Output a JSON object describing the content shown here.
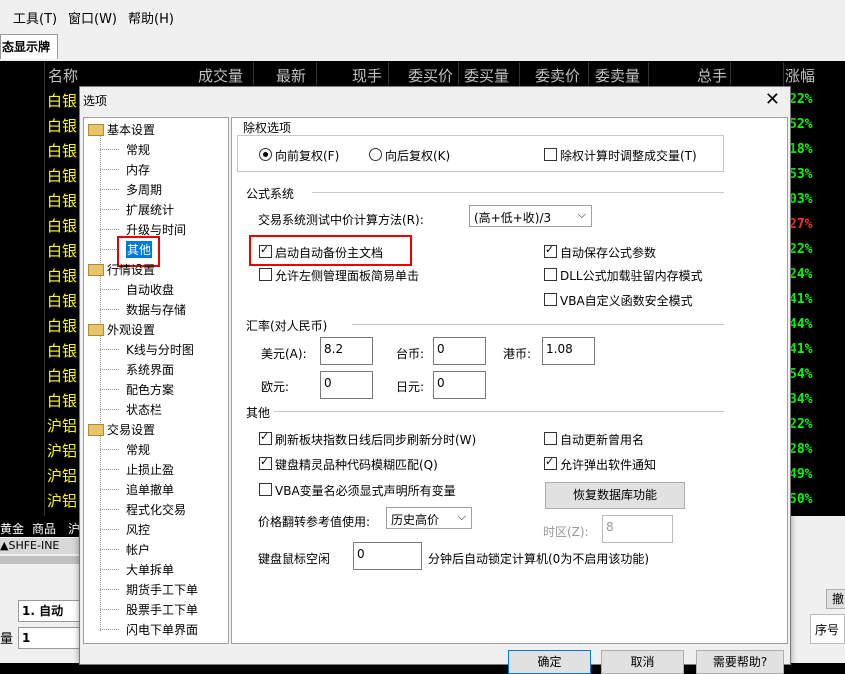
{
  "menubar": {
    "tools": "工具(T)",
    "window": "窗口(W)",
    "help": "帮助(H)"
  },
  "tab": {
    "label": "态显示牌"
  },
  "grid": {
    "headers": [
      "名称",
      "成交量",
      "最新",
      "现手",
      "委买价",
      "委买量",
      "委卖价",
      "委卖量",
      "总手",
      "涨幅"
    ],
    "rows": [
      {
        "name": "白银",
        "pct": "22%",
        "color": "#00ff00"
      },
      {
        "name": "白银",
        "pct": "52%",
        "color": "#00ff00"
      },
      {
        "name": "白银",
        "pct": "18%",
        "color": "#00ff00"
      },
      {
        "name": "白银",
        "pct": "53%",
        "color": "#00ff00"
      },
      {
        "name": "白银",
        "pct": "03%",
        "color": "#00ff00"
      },
      {
        "name": "白银",
        "pct": "27%",
        "color": "#ff3030"
      },
      {
        "name": "白银",
        "pct": "22%",
        "color": "#00ff00"
      },
      {
        "name": "白银",
        "pct": "24%",
        "color": "#00ff00"
      },
      {
        "name": "白银",
        "pct": "41%",
        "color": "#00ff00"
      },
      {
        "name": "白银",
        "pct": "44%",
        "color": "#00ff00"
      },
      {
        "name": "白银",
        "pct": "41%",
        "color": "#00ff00"
      },
      {
        "name": "白银",
        "pct": "54%",
        "color": "#00ff00"
      },
      {
        "name": "白银",
        "pct": "34%",
        "color": "#00ff00"
      },
      {
        "name": "沪铝",
        "pct": "22%",
        "color": "#00ff00"
      },
      {
        "name": "沪铝",
        "pct": "28%",
        "color": "#00ff00"
      },
      {
        "name": "沪铝",
        "pct": "49%",
        "color": "#00ff00"
      },
      {
        "name": "沪铝",
        "pct": "50%",
        "color": "#00ff00"
      }
    ]
  },
  "bottombar": {
    "tabs": [
      "黄金",
      "商品",
      "沪"
    ],
    "exchange": "▲SHFE-INE",
    "mode": "1. 自动",
    "qty_label": "量",
    "qty_value": "1",
    "btn_cancel_partial": "撤",
    "col_seq": "序号"
  },
  "dialog": {
    "title": "选项",
    "close": "✕",
    "tree": [
      {
        "label": "基本设置",
        "level": 0
      },
      {
        "label": "常规",
        "level": 1
      },
      {
        "label": "内存",
        "level": 1
      },
      {
        "label": "多周期",
        "level": 1
      },
      {
        "label": "扩展统计",
        "level": 1
      },
      {
        "label": "升级与时间",
        "level": 1
      },
      {
        "label": "其他",
        "level": 1,
        "selected": true
      },
      {
        "label": "行情设置",
        "level": 0
      },
      {
        "label": "自动收盘",
        "level": 1
      },
      {
        "label": "数据与存储",
        "level": 1
      },
      {
        "label": "外观设置",
        "level": 0
      },
      {
        "label": "K线与分时图",
        "level": 1
      },
      {
        "label": "系统界面",
        "level": 1
      },
      {
        "label": "配色方案",
        "level": 1
      },
      {
        "label": "状态栏",
        "level": 1
      },
      {
        "label": "交易设置",
        "level": 0
      },
      {
        "label": "常规",
        "level": 1
      },
      {
        "label": "止损止盈",
        "level": 1
      },
      {
        "label": "追单撤单",
        "level": 1
      },
      {
        "label": "程式化交易",
        "level": 1
      },
      {
        "label": "风控",
        "level": 1
      },
      {
        "label": "帐户",
        "level": 1
      },
      {
        "label": "大单拆单",
        "level": 1
      },
      {
        "label": "期货手工下单",
        "level": 1
      },
      {
        "label": "股票手工下单",
        "level": 1
      },
      {
        "label": "闪电下单界面",
        "level": 1
      }
    ],
    "exright": {
      "title": "除权选项",
      "forward": "向前复权(F)",
      "backward": "向后复权(K)",
      "adjust_volume": "除权计算时调整成交量(T)"
    },
    "formula": {
      "title": "公式系统",
      "test_label": "交易系统测试中价计算方法(R):",
      "test_value": "(高+低+收)/3",
      "auto_backup": "启动自动备份主文档",
      "auto_save": "自动保存公式参数",
      "left_click": "允许左侧管理面板简易单击",
      "dll_resident": "DLL公式加载驻留内存模式",
      "vba_safe": "VBA自定义函数安全模式"
    },
    "rate": {
      "title": "汇率(对人民币)",
      "usd_label": "美元(A):",
      "usd": "8.2",
      "twd_label": "台币:",
      "twd": "0",
      "hkd_label": "港币:",
      "hkd": "1.08",
      "eur_label": "欧元:",
      "eur": "0",
      "jpy_label": "日元:",
      "jpy": "0"
    },
    "other": {
      "title": "其他",
      "refresh": "刷新板块指数日线后同步刷新分时(W)",
      "auto_update": "自动更新曾用名",
      "fuzzy": "键盘精灵品种代码模糊匹配(Q)",
      "allow_popup": "允许弹出软件通知",
      "vba_declare": "VBA变量名必须显式声明所有变量",
      "restore_db": "恢复数据库功能",
      "price_ref_label": "价格翻转参考值使用:",
      "price_ref_value": "历史高价",
      "tz_label": "时区(Z):",
      "tz_value": "8",
      "idle_label": "键盘鼠标空闲",
      "idle_value": "0",
      "idle_suffix": "分钟后自动锁定计算机(0为不启用该功能)"
    },
    "buttons": {
      "ok": "确定",
      "cancel": "取消",
      "help": "需要帮助?"
    }
  },
  "colors": {
    "grid_bg": "#000000",
    "name_yellow": "#ffff00",
    "up_green": "#00ff00",
    "down_red": "#ff3030",
    "highlight_red": "#e00000",
    "selected_blue": "#0078d7"
  }
}
